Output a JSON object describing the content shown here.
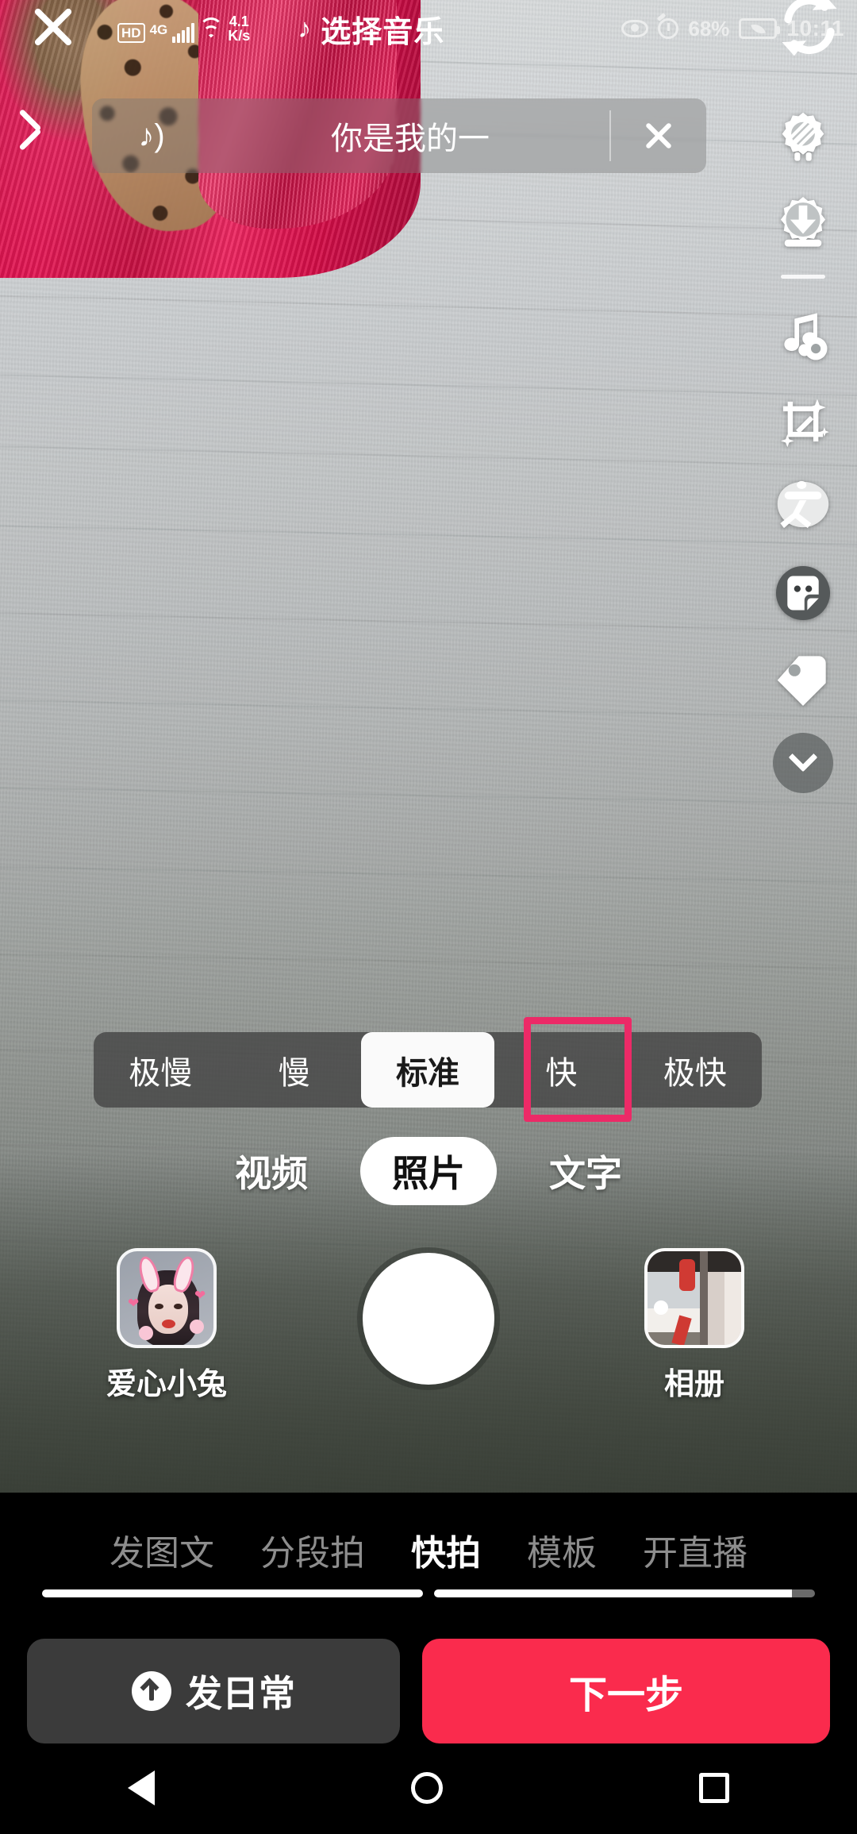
{
  "status_bar": {
    "hd_badge": "HD",
    "network_type": "4G",
    "net_speed_value": "4.1",
    "net_speed_unit": "K/s",
    "music_entry_label": "选择音乐",
    "music_note_icon": "music-note-icon",
    "eye_icon": "eye-icon",
    "alarm_icon": "alarm-clock-icon",
    "battery_percent": "68%",
    "battery_icon": "battery-eco-icon",
    "time": "10:11",
    "sync_icon": "sync-refresh-icon"
  },
  "close_button": {
    "icon": "close-x-icon"
  },
  "music_bar": {
    "back_icon": "back-chevron-icon",
    "music_icon": "music-note-icon",
    "title": "你是我的一",
    "close_icon": "close-icon"
  },
  "right_rail": {
    "items": [
      {
        "name": "flash-off-icon",
        "label": "闪光灯关闭"
      },
      {
        "name": "download-save-icon",
        "label": "保存"
      },
      {
        "name": "music-settings-icon",
        "label": "音乐设置"
      },
      {
        "name": "beautify-crop-icon",
        "label": "美化"
      },
      {
        "name": "text-icon",
        "label": "文"
      },
      {
        "name": "sticker-icon",
        "label": "贴纸"
      },
      {
        "name": "tag-icon",
        "label": "标签"
      }
    ],
    "expand_icon": "chevron-down-icon"
  },
  "speed_bar": {
    "options": [
      {
        "label": "极慢",
        "selected": false,
        "highlighted": false
      },
      {
        "label": "慢",
        "selected": false,
        "highlighted": false
      },
      {
        "label": "标准",
        "selected": true,
        "highlighted": false
      },
      {
        "label": "快",
        "selected": false,
        "highlighted": true
      },
      {
        "label": "极快",
        "selected": false,
        "highlighted": false
      }
    ],
    "highlight_color": "#ec2a67"
  },
  "mode_tabs": [
    {
      "label": "视频",
      "active": false
    },
    {
      "label": "照片",
      "active": true
    },
    {
      "label": "文字",
      "active": false
    }
  ],
  "capture_row": {
    "filter_label": "爱心小兔",
    "filter_thumb": "filter-thumbnail",
    "shutter": "shutter-button",
    "album_label": "相册",
    "album_thumb": "album-thumbnail"
  },
  "bottom_nav": [
    {
      "label": "发图文",
      "active": false
    },
    {
      "label": "分段拍",
      "active": false
    },
    {
      "label": "快拍",
      "active": true
    },
    {
      "label": "模板",
      "active": false
    },
    {
      "label": "开直播",
      "active": false
    }
  ],
  "actions": {
    "daily_label": "发日常",
    "daily_icon": "arrow-up-circle-icon",
    "next_label": "下一步",
    "next_color": "#fa2b4d"
  },
  "system_nav": {
    "back": "nav-back-icon",
    "home": "nav-home-icon",
    "recent": "nav-recent-icon"
  }
}
